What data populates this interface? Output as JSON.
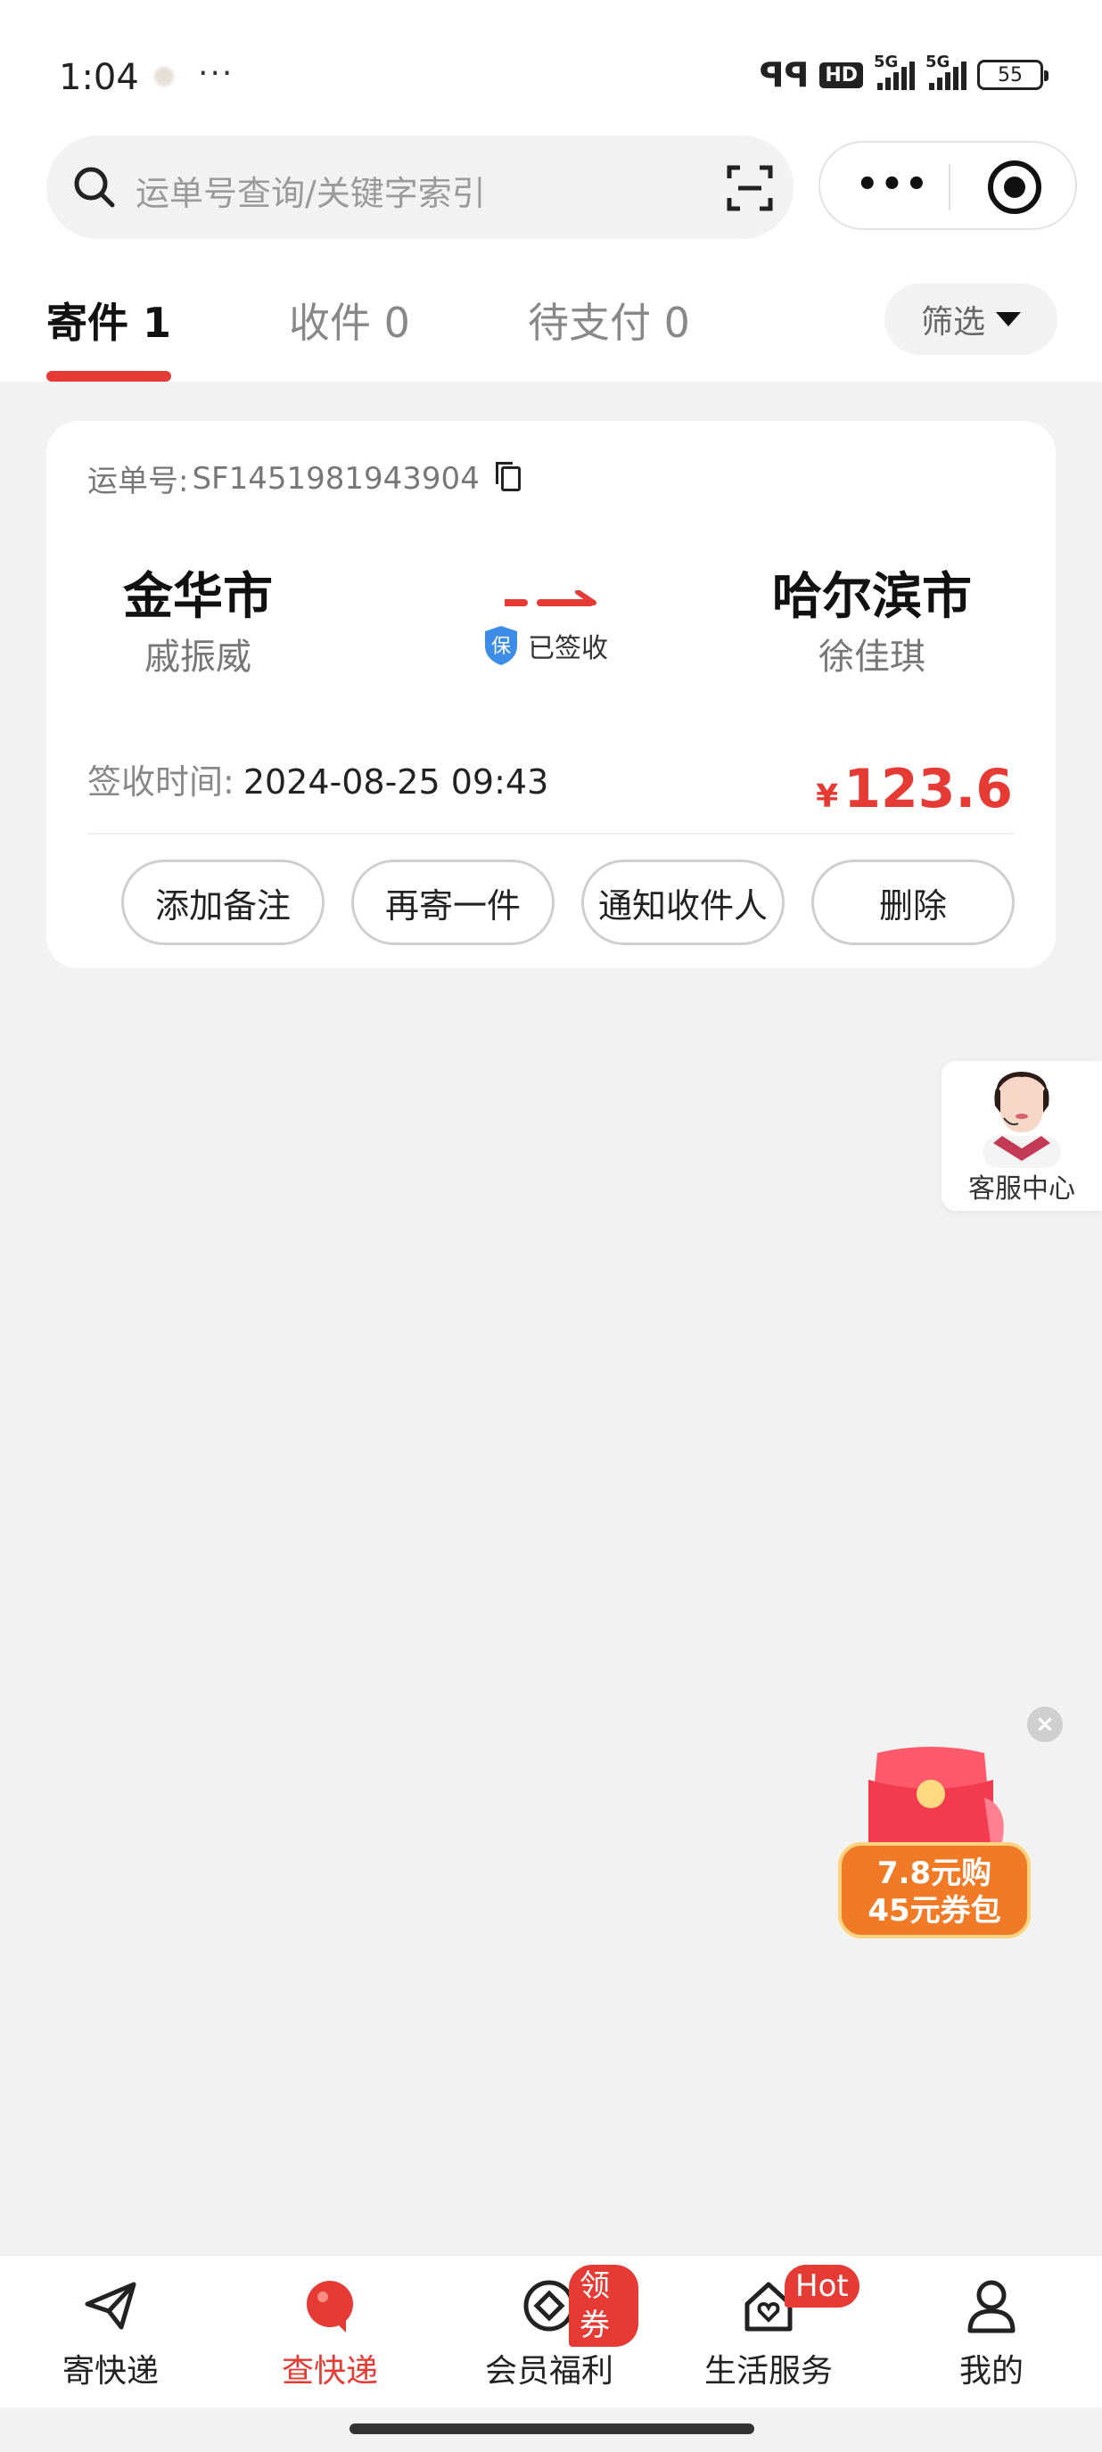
{
  "status_bar": {
    "time": "1:04",
    "more": "···",
    "hd": "HD",
    "network_1": "5G",
    "network_2": "5G",
    "battery": "55"
  },
  "search": {
    "placeholder": "运单号查询/关键字索引"
  },
  "tabs": [
    {
      "label": "寄件 1",
      "active": true
    },
    {
      "label": "收件 0",
      "active": false
    },
    {
      "label": "待支付 0",
      "active": false
    }
  ],
  "filter": {
    "label": "筛选"
  },
  "shipment": {
    "waybill_label": "运单号:",
    "waybill_number": "SF1451981943904",
    "from_city": "金华市",
    "from_person": "戚振威",
    "to_city": "哈尔滨市",
    "to_person": "徐佳琪",
    "status": "已签收",
    "sign_time_label": "签收时间:",
    "sign_time": "2024-08-25 09:43",
    "currency": "¥",
    "price": "123.6",
    "actions": [
      "添加备注",
      "再寄一件",
      "通知收件人",
      "删除"
    ]
  },
  "customer_service": {
    "label": "客服中心"
  },
  "promo": {
    "close": "×",
    "line1": "7.8元购",
    "line2": "45元券包"
  },
  "bottom_nav": [
    {
      "label": "寄快递",
      "icon": "paper-plane-icon",
      "active": false,
      "badge": ""
    },
    {
      "label": "查快递",
      "icon": "location-bubble-icon",
      "active": true,
      "badge": ""
    },
    {
      "label": "会员福利",
      "icon": "coin-icon",
      "active": false,
      "badge": "领券"
    },
    {
      "label": "生活服务",
      "icon": "home-heart-icon",
      "active": false,
      "badge": "Hot"
    },
    {
      "label": "我的",
      "icon": "user-icon",
      "active": false,
      "badge": ""
    }
  ],
  "colors": {
    "accent": "#e63b35",
    "background": "#f2f2f2",
    "card": "#ffffff"
  }
}
